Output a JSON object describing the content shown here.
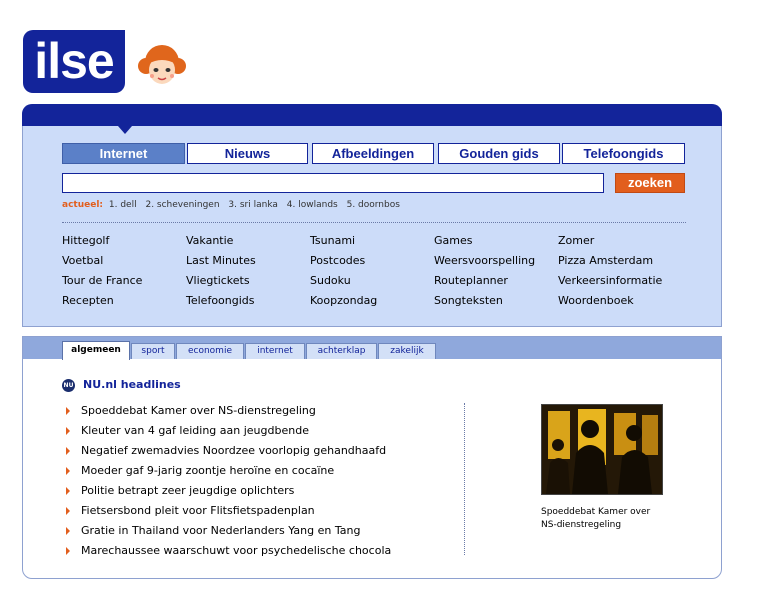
{
  "logo": {
    "text": "ilse"
  },
  "search": {
    "tabs": [
      {
        "label": "Internet",
        "active": true
      },
      {
        "label": "Nieuws"
      },
      {
        "label": "Afbeeldingen"
      },
      {
        "label": "Gouden gids"
      },
      {
        "label": "Telefoongids"
      }
    ],
    "input_value": "",
    "button_label": "zoeken",
    "actueel_label": "actueel:",
    "actueel_items": [
      "1. dell",
      "2. scheveningen",
      "3. sri lanka",
      "4. lowlands",
      "5. doornbos"
    ]
  },
  "quick_links": [
    [
      "Hittegolf",
      "Voetbal",
      "Tour de France",
      "Recepten"
    ],
    [
      "Vakantie",
      "Last Minutes",
      "Vliegtickets",
      "Telefoongids"
    ],
    [
      "Tsunami",
      "Postcodes",
      "Sudoku",
      "Koopzondag"
    ],
    [
      "Games",
      "Weersvoorspelling",
      "Routeplanner",
      "Songteksten"
    ],
    [
      "Zomer",
      "Pizza Amsterdam",
      "Verkeersinformatie",
      "Woordenboek"
    ]
  ],
  "news": {
    "tabs": [
      {
        "label": "algemeen",
        "active": true
      },
      {
        "label": "sport"
      },
      {
        "label": "economie"
      },
      {
        "label": "internet"
      },
      {
        "label": "achterklap"
      },
      {
        "label": "zakelijk"
      }
    ],
    "source_icon_text": "NU",
    "source_title": "NU.nl headlines",
    "headlines": [
      "Spoeddebat Kamer over NS-dienstregeling",
      "Kleuter van 4 gaf leiding aan jeugdbende",
      "Negatief zwemadvies Noordzee voorlopig gehandhaafd",
      "Moeder gaf 9-jarig zoontje heroïne en cocaïne",
      "Politie betrapt zeer jeugdige oplichters",
      "Fietsersbond pleit voor Flitsfietspadenplan",
      "Gratie in Thailand voor Nederlanders Yang en Tang",
      "Marechaussee waarschuwt voor psychedelische chocola"
    ],
    "photo_caption": "Spoeddebat Kamer over NS-dienstregeling"
  },
  "colors": {
    "brand_blue": "#13249a",
    "panel_bg": "#ccdcf9",
    "accent_orange": "#e25e1d",
    "tab_active": "#5b80c8"
  }
}
